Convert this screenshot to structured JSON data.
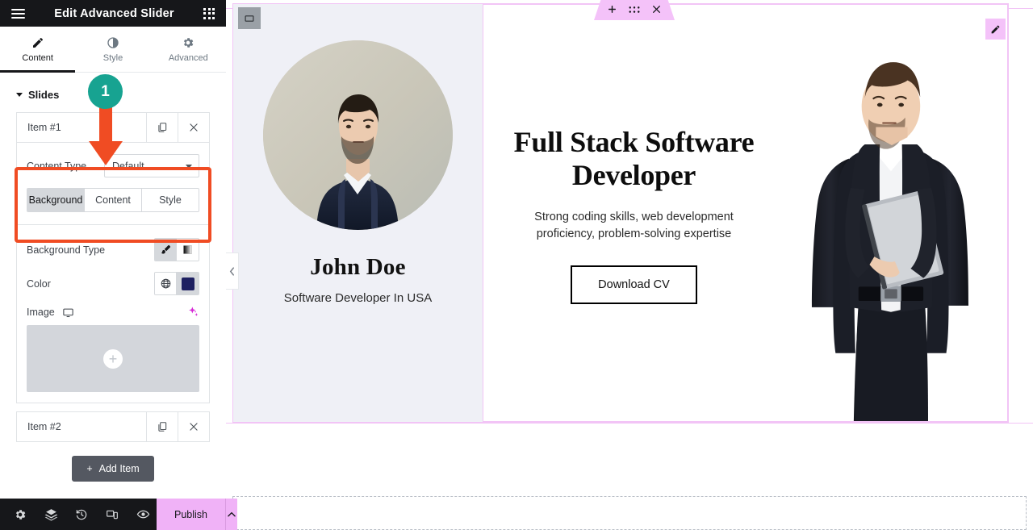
{
  "panel": {
    "title": "Edit Advanced Slider",
    "menu_icon": "hamburger-icon",
    "apps_icon": "grid-apps-icon",
    "tabs": [
      {
        "label": "Content",
        "icon": "pencil-icon",
        "active": true
      },
      {
        "label": "Style",
        "icon": "contrast-half-circle-icon",
        "active": false
      },
      {
        "label": "Advanced",
        "icon": "gear-icon",
        "active": false
      }
    ],
    "section": {
      "label": "Slides",
      "expanded": true
    },
    "repeater": {
      "items": [
        {
          "label": "Item #1",
          "expanded": true,
          "duplicate_icon": "copy-icon",
          "remove_icon": "close-x-icon"
        },
        {
          "label": "Item #2",
          "expanded": false,
          "duplicate_icon": "copy-icon",
          "remove_icon": "close-x-icon"
        }
      ]
    },
    "item_controls": {
      "content_type": {
        "label": "Content Type",
        "value": "Default",
        "options": [
          "Default"
        ]
      },
      "tabs": [
        {
          "label": "Background",
          "active": true
        },
        {
          "label": "Content",
          "active": false
        },
        {
          "label": "Style",
          "active": false
        }
      ],
      "background_type": {
        "label": "Background Type",
        "choices": [
          {
            "icon": "paint-brush-icon",
            "title": "Classic",
            "active": true
          },
          {
            "icon": "gradient-icon",
            "title": "Gradient",
            "active": false
          }
        ]
      },
      "color": {
        "label": "Color",
        "global_icon": "globe-icon",
        "swatch_hex": "#1e2061"
      },
      "image": {
        "label": "Image",
        "device_icon": "desktop-monitor-icon",
        "ai_icon": "ai-sparkle-icon",
        "placeholder_icon": "plus-icon"
      }
    },
    "add_item": {
      "label": "Add Item",
      "icon": "plus-icon"
    },
    "collapse_handle_icon": "chevron-left-icon"
  },
  "bottombar": {
    "icons": [
      {
        "name": "settings-gear-icon"
      },
      {
        "name": "navigator-layers-icon"
      },
      {
        "name": "history-clock-icon"
      },
      {
        "name": "responsive-devices-icon"
      },
      {
        "name": "preview-eye-icon"
      }
    ],
    "publish": {
      "label": "Publish",
      "arrow_icon": "chevron-up-icon",
      "color": "#f0b2f7"
    }
  },
  "canvas": {
    "section_toolbar": {
      "add_icon": "plus-icon",
      "drag_icon": "drag-dots-icon",
      "close_icon": "close-x-icon"
    },
    "widget_handle_icon": "widget-box-icon",
    "edit_badge_icon": "pencil-icon",
    "slide": {
      "profile": {
        "name": "John Doe",
        "subtitle": "Software Developer In USA",
        "photo_alt": "portrait-of-bearded-man-in-navy-suit",
        "background_hex": "#eff0f6"
      },
      "hero": {
        "title": "Full Stack Software Developer",
        "subtitle": "Strong coding skills, web development proficiency, problem-solving expertise",
        "button_label": "Download CV",
        "photo_alt": "standing-man-in-black-suit-holding-laptop"
      }
    },
    "accent_outline_hex": "#f2c4f6"
  },
  "annotation": {
    "badge_number": "1",
    "badge_color": "#17a391",
    "arrow_color": "#f04c23",
    "highlight_color": "#f04c23"
  }
}
